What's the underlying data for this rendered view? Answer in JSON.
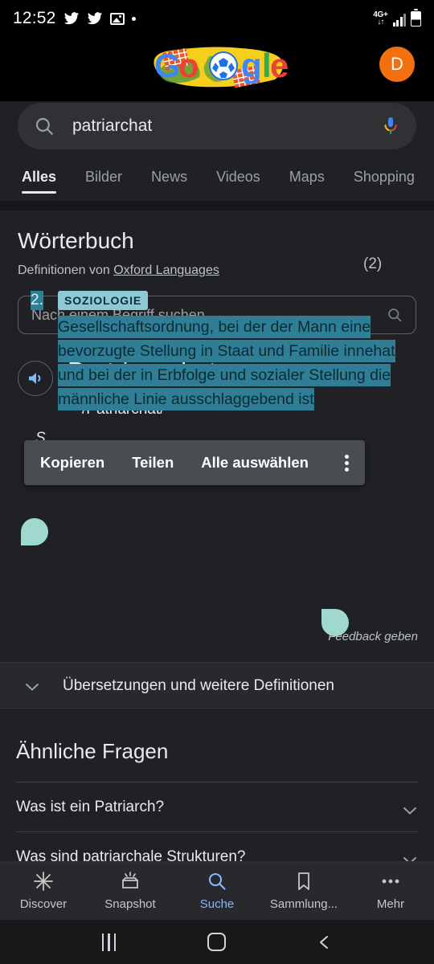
{
  "status_bar": {
    "time": "12:52",
    "icons": [
      "twitter-icon",
      "twitter-icon",
      "photo-icon",
      "dot-icon"
    ],
    "network_label": "4G+",
    "network_arrows": "↓↑"
  },
  "header": {
    "doodle_alt": "google-doodle-football",
    "avatar_initial": "D"
  },
  "search": {
    "query": "patriarchat",
    "search_icon": "search-icon",
    "mic_icon": "microphone-icon"
  },
  "tabs": [
    {
      "label": "Alles",
      "active": true
    },
    {
      "label": "Bilder",
      "active": false
    },
    {
      "label": "News",
      "active": false
    },
    {
      "label": "Videos",
      "active": false
    },
    {
      "label": "Maps",
      "active": false
    },
    {
      "label": "Shopping",
      "active": false
    }
  ],
  "dictionary": {
    "title": "Wörterbuch",
    "source_prefix": "Definitionen von",
    "source_link": "Oxford Languages",
    "term_search_placeholder": "Nach einem Begriff suchen",
    "word": "Pa·tri·ar·chat",
    "phonetic": "/Patriarchát/",
    "part_of_speech": "S",
    "sense_count": "(2)",
    "definition": {
      "number": "2.",
      "label": "SOZIOLOGIE",
      "text": "Gesellschaftsordnung, bei der der Mann eine bevorzugte Stellung in Staat und Familie innehat und bei der in Erbfolge und sozialer Stellung die männliche Linie ausschlaggebend ist"
    },
    "feedback_label": "Feedback geben",
    "expander_label": "Übersetzungen und weitere Definitionen"
  },
  "context_menu": {
    "items": [
      "Kopieren",
      "Teilen",
      "Alle auswählen"
    ],
    "overflow_icon": "more-vertical-icon"
  },
  "people_also_ask": {
    "title": "Ähnliche Fragen",
    "questions": [
      "Was ist ein Patriarch?",
      "Was sind patriarchale Strukturen?"
    ]
  },
  "bottom_nav": [
    {
      "label": "Discover",
      "icon": "asterisk-icon",
      "active": false
    },
    {
      "label": "Snapshot",
      "icon": "snapshot-icon",
      "active": false
    },
    {
      "label": "Suche",
      "icon": "search-icon",
      "active": true
    },
    {
      "label": "Sammlung...",
      "icon": "bookmark-icon",
      "active": false
    },
    {
      "label": "Mehr",
      "icon": "more-horizontal-icon",
      "active": false
    }
  ],
  "android_nav": {
    "recents": "recents-icon",
    "home": "home-icon",
    "back": "back-icon"
  },
  "colors": {
    "background": "#202124",
    "accent_blue": "#8ab4f8",
    "selection": "#2f7e96",
    "handle": "#9fd8cf",
    "avatar": "#f2700f"
  }
}
